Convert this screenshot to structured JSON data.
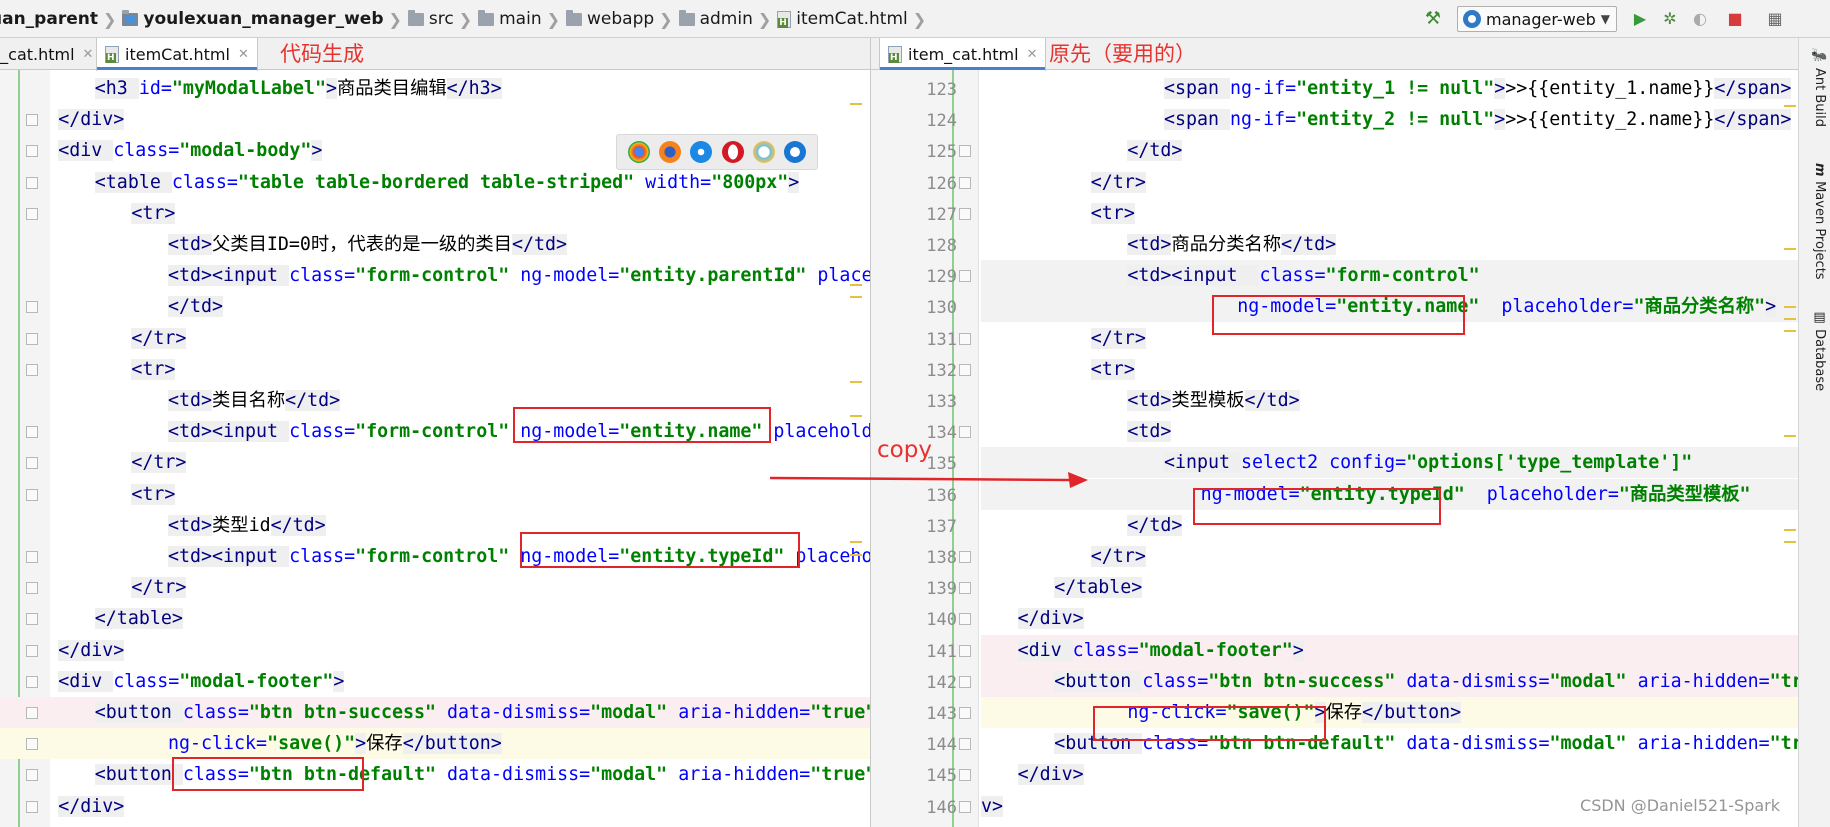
{
  "breadcrumb": [
    {
      "label": "uan_parent",
      "icon": "folder-icon",
      "bold": true
    },
    {
      "label": "youlexuan_manager_web",
      "icon": "module-folder-icon",
      "bold": true
    },
    {
      "label": "src",
      "icon": "folder-icon",
      "bold": false
    },
    {
      "label": "main",
      "icon": "folder-icon",
      "bold": false
    },
    {
      "label": "webapp",
      "icon": "folder-icon",
      "bold": false
    },
    {
      "label": "admin",
      "icon": "folder-icon",
      "bold": false
    },
    {
      "label": "itemCat.html",
      "icon": "html-file-icon",
      "bold": false
    }
  ],
  "toolbar": {
    "run_config": "manager-web",
    "icons": [
      "build-hammer-icon",
      "run-icon",
      "debug-icon",
      "coverage-icon",
      "stop-icon",
      "project-structure-icon"
    ]
  },
  "left_pane": {
    "tabs": [
      {
        "label": "n_cat.html"
      },
      {
        "label": "itemCat.html",
        "active": true
      }
    ],
    "annotation": "代码生成",
    "lines": [
      {
        "indent": 3,
        "tokens": [
          [
            "tag",
            "<h3 "
          ],
          [
            "attr",
            "id="
          ],
          [
            "val",
            "\"myModalLabel\""
          ],
          [
            "tag",
            ">"
          ],
          [
            "text",
            "商品类目编辑"
          ],
          [
            "tag",
            "</h3>"
          ]
        ]
      },
      {
        "indent": 2,
        "tokens": [
          [
            "tag",
            "</div>"
          ]
        ]
      },
      {
        "indent": 2,
        "tokens": [
          [
            "tag",
            "<div "
          ],
          [
            "attr",
            "class="
          ],
          [
            "val",
            "\"modal-body\""
          ],
          [
            "tag",
            ">"
          ]
        ]
      },
      {
        "indent": 3,
        "tokens": [
          [
            "tag",
            "<table "
          ],
          [
            "attr",
            "class="
          ],
          [
            "val",
            "\"table table-bordered table-striped\""
          ],
          [
            "text",
            " "
          ],
          [
            "attr",
            "width="
          ],
          [
            "val",
            "\"800px\""
          ],
          [
            "tag",
            ">"
          ]
        ]
      },
      {
        "indent": 4,
        "tokens": [
          [
            "tag",
            "<tr>"
          ]
        ]
      },
      {
        "indent": 5,
        "tokens": [
          [
            "tag",
            "<td>"
          ],
          [
            "text",
            "父类目ID=0时，代表的是一级的类目"
          ],
          [
            "tag",
            "</td>"
          ]
        ]
      },
      {
        "indent": 5,
        "tokens": [
          [
            "tag",
            "<td>"
          ],
          [
            "tag",
            "<input "
          ],
          [
            "attr",
            "class="
          ],
          [
            "val",
            "\"form-control\""
          ],
          [
            "text",
            " "
          ],
          [
            "attr",
            "ng-model="
          ],
          [
            "val",
            "\"entity.parentId\""
          ],
          [
            "text",
            " "
          ],
          [
            "attr",
            "placeholder"
          ]
        ]
      },
      {
        "indent": 5,
        "tokens": [
          [
            "tag",
            "</td>"
          ]
        ]
      },
      {
        "indent": 4,
        "tokens": [
          [
            "tag",
            "</tr>"
          ]
        ]
      },
      {
        "indent": 4,
        "tokens": [
          [
            "tag",
            "<tr>"
          ]
        ]
      },
      {
        "indent": 5,
        "tokens": [
          [
            "tag",
            "<td>"
          ],
          [
            "text",
            "类目名称"
          ],
          [
            "tag",
            "</td>"
          ]
        ]
      },
      {
        "indent": 5,
        "tokens": [
          [
            "tag",
            "<td>"
          ],
          [
            "tag",
            "<input "
          ],
          [
            "attr",
            "class="
          ],
          [
            "val",
            "\"form-control\""
          ],
          [
            "text",
            " "
          ],
          [
            "attr",
            "ng-model="
          ],
          [
            "val",
            "\"entity.name\""
          ],
          [
            "text",
            " "
          ],
          [
            "attr",
            "placeholder"
          ]
        ]
      },
      {
        "indent": 4,
        "tokens": [
          [
            "tag",
            "</tr>"
          ]
        ]
      },
      {
        "indent": 4,
        "tokens": [
          [
            "tag",
            "<tr>"
          ]
        ]
      },
      {
        "indent": 5,
        "tokens": [
          [
            "tag",
            "<td>"
          ],
          [
            "text",
            "类型id"
          ],
          [
            "tag",
            "</td>"
          ]
        ]
      },
      {
        "indent": 5,
        "tokens": [
          [
            "tag",
            "<td>"
          ],
          [
            "tag",
            "<input "
          ],
          [
            "attr",
            "class="
          ],
          [
            "val",
            "\"form-control\""
          ],
          [
            "text",
            " "
          ],
          [
            "attr",
            "ng-model="
          ],
          [
            "val",
            "\"entity.typeId\""
          ],
          [
            "text",
            " "
          ],
          [
            "attr",
            "placeholder"
          ]
        ]
      },
      {
        "indent": 4,
        "tokens": [
          [
            "tag",
            "</tr>"
          ]
        ]
      },
      {
        "indent": 3,
        "tokens": [
          [
            "tag",
            "</table>"
          ]
        ]
      },
      {
        "indent": 2,
        "tokens": [
          [
            "tag",
            "</div>"
          ]
        ]
      },
      {
        "indent": 2,
        "tokens": [
          [
            "tag",
            "<div "
          ],
          [
            "attr",
            "class="
          ],
          [
            "val",
            "\"modal-footer\""
          ],
          [
            "tag",
            ">"
          ]
        ]
      },
      {
        "indent": 3,
        "tokens": [
          [
            "tag",
            "<button "
          ],
          [
            "attr",
            "class="
          ],
          [
            "val",
            "\"btn btn-success\""
          ],
          [
            "text",
            " "
          ],
          [
            "attr",
            "data-dismiss="
          ],
          [
            "val",
            "\"modal\""
          ],
          [
            "text",
            " "
          ],
          [
            "attr",
            "aria-hidden="
          ],
          [
            "val",
            "\"true\""
          ]
        ]
      },
      {
        "indent": 5,
        "tokens": [
          [
            "attr",
            "ng-click="
          ],
          [
            "val",
            "\"save()\""
          ],
          [
            "tag",
            ">"
          ],
          [
            "text",
            "保存"
          ],
          [
            "tag",
            "</button>"
          ]
        ]
      },
      {
        "indent": 3,
        "tokens": [
          [
            "tag",
            "<button "
          ],
          [
            "attr",
            "class="
          ],
          [
            "val",
            "\"btn btn-default\""
          ],
          [
            "text",
            " "
          ],
          [
            "attr",
            "data-dismiss="
          ],
          [
            "val",
            "\"modal\""
          ],
          [
            "text",
            " "
          ],
          [
            "attr",
            "aria-hidden="
          ],
          [
            "val",
            "\"true\""
          ]
        ]
      },
      {
        "indent": 2,
        "tokens": [
          [
            "tag",
            "</div>"
          ]
        ]
      }
    ]
  },
  "right_pane": {
    "tabs": [
      {
        "label": "item_cat.html",
        "active": true
      }
    ],
    "annotation": "原先（要用的）",
    "lines": [
      {
        "no": "123",
        "indent": 5,
        "tokens": [
          [
            "tag",
            "<span "
          ],
          [
            "attr",
            "ng-if="
          ],
          [
            "val",
            "\"entity_1 != null\""
          ],
          [
            "tag",
            ">"
          ],
          [
            "text",
            ">>"
          ],
          [
            "mus",
            "{{entity_1.name}}"
          ],
          [
            "tag",
            "</span>"
          ]
        ]
      },
      {
        "no": "124",
        "indent": 5,
        "tokens": [
          [
            "tag",
            "<span "
          ],
          [
            "attr",
            "ng-if="
          ],
          [
            "val",
            "\"entity_2 != null\""
          ],
          [
            "tag",
            ">"
          ],
          [
            "text",
            ">>"
          ],
          [
            "mus",
            "{{entity_2.name}}"
          ],
          [
            "tag",
            "</span>"
          ]
        ]
      },
      {
        "no": "125",
        "indent": 4,
        "tokens": [
          [
            "tag",
            "</td>"
          ]
        ]
      },
      {
        "no": "126",
        "indent": 3,
        "tokens": [
          [
            "tag",
            "</tr>"
          ]
        ]
      },
      {
        "no": "127",
        "indent": 3,
        "tokens": [
          [
            "tag",
            "<tr>"
          ]
        ]
      },
      {
        "no": "128",
        "indent": 4,
        "tokens": [
          [
            "tag",
            "<td>"
          ],
          [
            "text",
            "商品分类名称"
          ],
          [
            "tag",
            "</td>"
          ]
        ]
      },
      {
        "no": "129",
        "indent": 4,
        "tokens": [
          [
            "tag",
            "<td>"
          ],
          [
            "tag",
            "<input  "
          ],
          [
            "attr",
            "class="
          ],
          [
            "val",
            "\"form-control\""
          ]
        ]
      },
      {
        "no": "130",
        "indent": 7,
        "tokens": [
          [
            "attr",
            "ng-model="
          ],
          [
            "val",
            "\"entity.name\""
          ],
          [
            "text",
            "  "
          ],
          [
            "attr",
            "placeholder="
          ],
          [
            "val",
            "\"商品分类名称\""
          ],
          [
            "tag",
            ">"
          ]
        ]
      },
      {
        "no": "131",
        "indent": 3,
        "tokens": [
          [
            "tag",
            "</tr>"
          ]
        ]
      },
      {
        "no": "132",
        "indent": 3,
        "tokens": [
          [
            "tag",
            "<tr>"
          ]
        ]
      },
      {
        "no": "133",
        "indent": 4,
        "tokens": [
          [
            "tag",
            "<td>"
          ],
          [
            "text",
            "类型模板"
          ],
          [
            "tag",
            "</td>"
          ]
        ]
      },
      {
        "no": "134",
        "indent": 4,
        "tokens": [
          [
            "tag",
            "<td>"
          ]
        ]
      },
      {
        "no": "135",
        "indent": 5,
        "tokens": [
          [
            "tag",
            "<input "
          ],
          [
            "attr",
            "select2 "
          ],
          [
            "attr",
            "config="
          ],
          [
            "val",
            "\"options['type_template']\""
          ]
        ]
      },
      {
        "no": "136",
        "indent": 6,
        "tokens": [
          [
            "attr",
            "ng-model="
          ],
          [
            "val",
            "\"entity.typeId\""
          ],
          [
            "text",
            "  "
          ],
          [
            "attr",
            "placeholder="
          ],
          [
            "val",
            "\"商品类型模板\""
          ]
        ]
      },
      {
        "no": "137",
        "indent": 4,
        "tokens": [
          [
            "tag",
            "</td>"
          ]
        ]
      },
      {
        "no": "138",
        "indent": 3,
        "tokens": [
          [
            "tag",
            "</tr>"
          ]
        ]
      },
      {
        "no": "139",
        "indent": 2,
        "tokens": [
          [
            "tag",
            "</table>"
          ]
        ]
      },
      {
        "no": "140",
        "indent": 1,
        "tokens": [
          [
            "tag",
            "</div>"
          ]
        ]
      },
      {
        "no": "141",
        "indent": 1,
        "tokens": [
          [
            "tag",
            "<div "
          ],
          [
            "attr",
            "class="
          ],
          [
            "val",
            "\"modal-footer\""
          ],
          [
            "tag",
            ">"
          ]
        ]
      },
      {
        "no": "142",
        "indent": 2,
        "tokens": [
          [
            "tag",
            "<button "
          ],
          [
            "attr",
            "class="
          ],
          [
            "val",
            "\"btn btn-success\""
          ],
          [
            "text",
            " "
          ],
          [
            "attr",
            "data-dismiss="
          ],
          [
            "val",
            "\"modal\""
          ],
          [
            "text",
            " "
          ],
          [
            "attr",
            "aria-hidden="
          ],
          [
            "val",
            "\"true\""
          ]
        ]
      },
      {
        "no": "143",
        "indent": 4,
        "tokens": [
          [
            "attr",
            "ng-click="
          ],
          [
            "val",
            "\"save()\""
          ],
          [
            "tag",
            ">"
          ],
          [
            "text",
            "保存"
          ],
          [
            "tag",
            "</button>"
          ]
        ]
      },
      {
        "no": "144",
        "indent": 2,
        "tokens": [
          [
            "tag",
            "<button "
          ],
          [
            "attr",
            "class="
          ],
          [
            "val",
            "\"btn btn-default\""
          ],
          [
            "text",
            " "
          ],
          [
            "attr",
            "data-dismiss="
          ],
          [
            "val",
            "\"modal\""
          ],
          [
            "text",
            " "
          ],
          [
            "attr",
            "aria-hidden="
          ],
          [
            "val",
            "\"true\""
          ]
        ]
      },
      {
        "no": "145",
        "indent": 1,
        "tokens": [
          [
            "tag",
            "</div>"
          ]
        ]
      },
      {
        "no": "146",
        "indent": 0,
        "tokens": [
          [
            "tag",
            "v>"
          ]
        ]
      }
    ]
  },
  "copy_label": "copy",
  "browser_icons": [
    "chrome-icon",
    "firefox-icon",
    "safari-icon",
    "opera-icon",
    "ie-icon",
    "edge-icon"
  ],
  "tool_windows": [
    "Ant Build",
    "Maven Projects",
    "Database"
  ],
  "watermark": "CSDN @Daniel521-Spark",
  "colors": {
    "annotation_red": "#e8322e",
    "highlight_box": "#e0262a",
    "tag": "#000080",
    "attr": "#0000ff",
    "value": "#008000"
  }
}
